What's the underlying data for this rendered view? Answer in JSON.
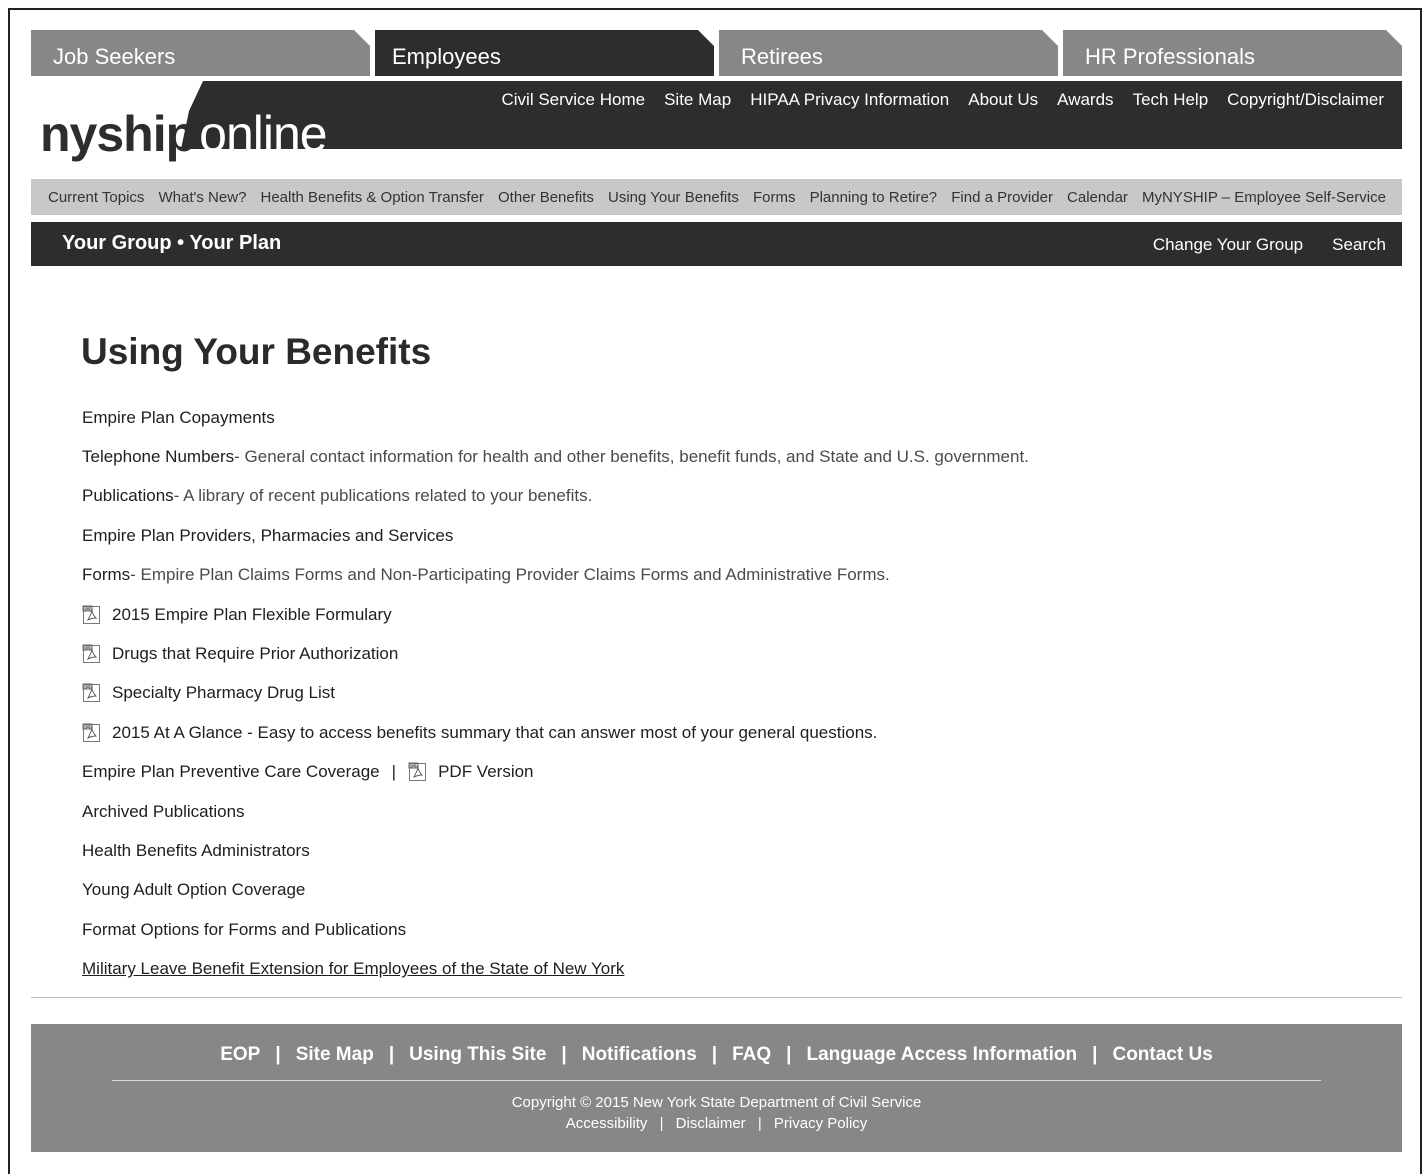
{
  "audience_tabs": [
    {
      "label": "Job Seekers",
      "active": false
    },
    {
      "label": "Employees",
      "active": true
    },
    {
      "label": "Retirees",
      "active": false
    },
    {
      "label": "HR Professionals",
      "active": false
    }
  ],
  "logo": {
    "part1": "nyship",
    "part2": "online"
  },
  "top_nav": [
    "Civil Service Home",
    "Site Map",
    "HIPAA Privacy Information",
    "About Us",
    "Awards",
    "Tech Help",
    "Copyright/Disclaimer"
  ],
  "main_nav": [
    "Current Topics",
    "What's New?",
    "Health Benefits & Option Transfer",
    "Other Benefits",
    "Using Your Benefits",
    "Forms",
    "Planning to Retire?",
    "Find a Provider",
    "Calendar",
    "MyNYSHIP – Employee Self-Service"
  ],
  "group_bar": {
    "title": "Your Group • Your Plan",
    "change_group": "Change Your Group",
    "search": "Search"
  },
  "page_title": "Using Your Benefits",
  "links": [
    {
      "label": "Empire Plan Copayments"
    },
    {
      "label": "Telephone Numbers",
      "desc": " - General contact information for health and other benefits, benefit funds, and State and U.S. government."
    },
    {
      "label": "Publications",
      "desc": " - A library of recent publications related to your benefits."
    },
    {
      "label": "Empire Plan Providers, Pharmacies and Services"
    },
    {
      "label": "Forms",
      "desc": " - Empire Plan Claims Forms and Non-Participating Provider Claims Forms and Administrative Forms."
    },
    {
      "label": "2015 Empire Plan Flexible Formulary",
      "pdf": true
    },
    {
      "label": "Drugs that Require Prior Authorization",
      "pdf": true
    },
    {
      "label": "Specialty Pharmacy Drug List",
      "pdf": true
    },
    {
      "label": "2015 At A Glance - Easy to access benefits summary that can answer most of your general questions.",
      "pdf": true
    },
    {
      "label": "Empire Plan Preventive Care Coverage",
      "separator": "|",
      "pdf_version_label": "PDF Version"
    },
    {
      "label": "Archived Publications"
    },
    {
      "label": "Health Benefits Administrators"
    },
    {
      "label": "Young Adult Option Coverage"
    },
    {
      "label": "Format Options for Forms and Publications"
    },
    {
      "label": "Military Leave Benefit Extension for Employees of the State of New York",
      "underline": true
    }
  ],
  "footer": {
    "nav": [
      "EOP",
      "Site Map",
      "Using This Site",
      "Notifications",
      "FAQ",
      "Language Access Information",
      "Contact Us"
    ],
    "separator": "|",
    "copyright": "Copyright © 2015 New York State Department of Civil Service",
    "legal": [
      "Accessibility",
      "Disclaimer",
      "Privacy Policy"
    ]
  },
  "colors": {
    "dark": "#2d2d2d",
    "mid_gray": "#878787",
    "light_gray": "#c8c8c8"
  },
  "icons": {
    "pdf": "pdf-file-icon"
  }
}
